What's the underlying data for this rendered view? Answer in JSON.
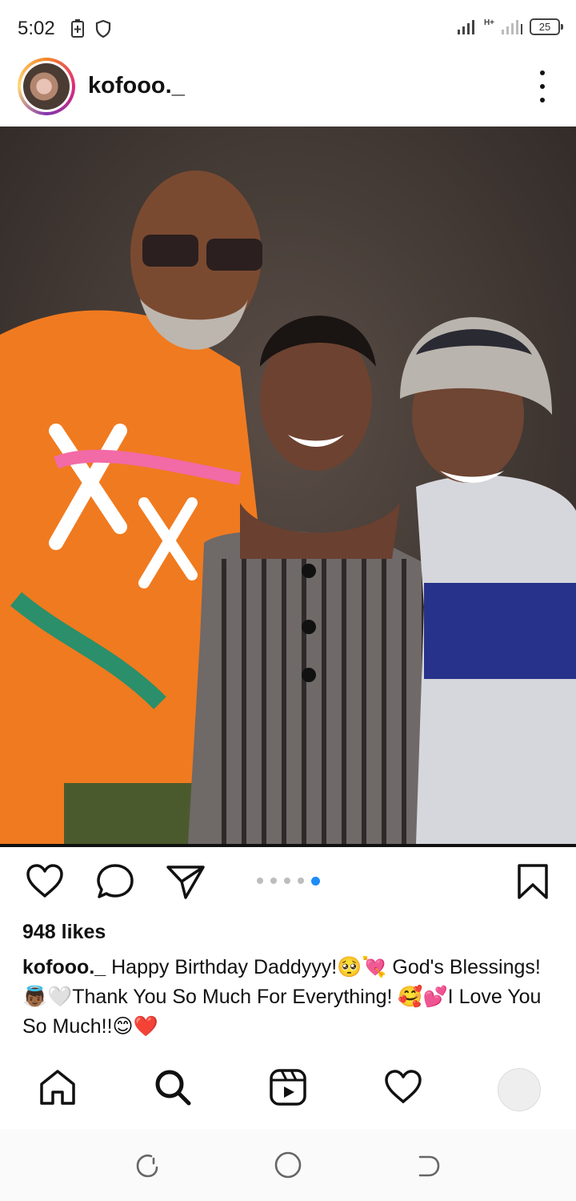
{
  "status_bar": {
    "time": "5:02",
    "battery": "25",
    "network": "H+"
  },
  "post": {
    "username": "kofooo._",
    "likes": "948 likes",
    "caption_user": "kofooo._",
    "caption_text": "Happy Birthday Daddyyy!🥺💘 God's Blessings!👼🏾🤍Thank You So Much For Everything! 🥰💕I Love You So Much!!😊❤️",
    "carousel": {
      "count": 5,
      "active": 5
    }
  },
  "icons": {
    "more": "more-vertical-icon",
    "like": "heart-icon",
    "comment": "comment-icon",
    "share": "send-icon",
    "save": "bookmark-icon",
    "home": "home-icon",
    "search": "search-icon",
    "reels": "reels-icon",
    "activity": "heart-icon",
    "profile": "profile-avatar"
  },
  "colors": {
    "accent": "#1d8cf8",
    "text": "#111111"
  }
}
